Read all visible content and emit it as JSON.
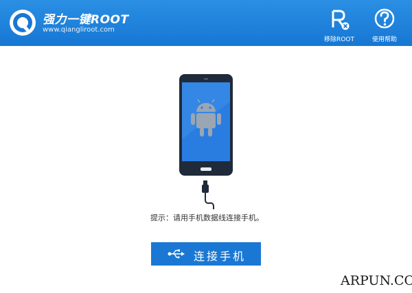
{
  "header": {
    "title": "强力一键ROOT",
    "url": "www.qiangliroot.com",
    "buttons": [
      {
        "label": "移除ROOT",
        "icon": "remove-root-icon"
      },
      {
        "label": "使用帮助",
        "icon": "help-icon"
      }
    ]
  },
  "main": {
    "illustration": [
      "phone-icon",
      "android-icon",
      "usb-cable-icon"
    ],
    "tip": "提示：请用手机数据线连接手机。",
    "connect_button": {
      "label": "连接手机",
      "icon": "usb-icon"
    }
  },
  "watermark": "ARPUN.COM",
  "colors": {
    "header_bg": "#1f84dc",
    "button_bg": "#1a78d4",
    "screen_blue": "#2a7de0",
    "phone_body": "#1f2b3a"
  }
}
